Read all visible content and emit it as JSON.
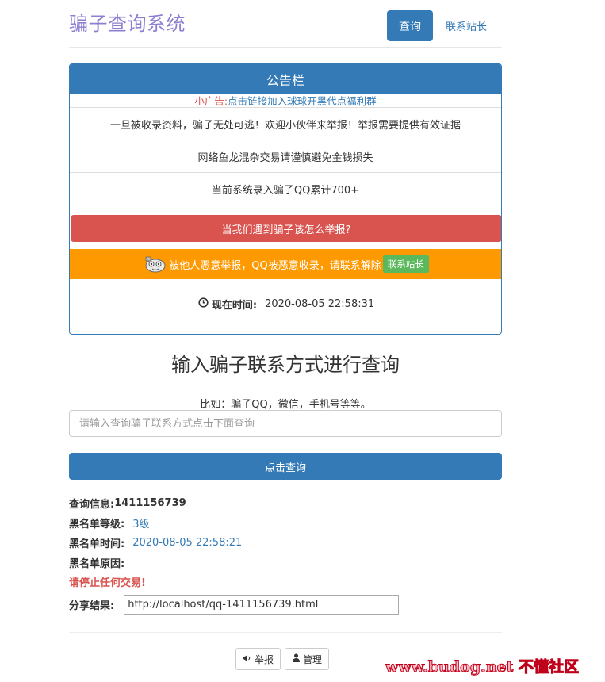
{
  "header": {
    "brand": "骗子查询系统",
    "nav_query": "查询",
    "nav_contact": "联系站长"
  },
  "panel": {
    "title": "公告栏",
    "ad_prefix": "小广告:",
    "ad_link": "点击链接加入球球开黑代点福利群",
    "notices": [
      "一旦被收录资料，骗子无处可逃！欢迎小伙伴来举报！举报需要提供有效证据",
      "网络鱼龙混杂交易请谨慎避免金钱损失",
      "当前系统录入骗子QQ累计700+"
    ],
    "report_button": "当我们遇到骗子该怎么举报?",
    "complaint_text": "被他人恶意举报，QQ被恶意收录，请联系解除",
    "contact_badge": "联系站长",
    "time_label": "现在时间:",
    "time_value": "2020-08-05 22:58:31"
  },
  "search": {
    "title": "输入骗子联系方式进行查询",
    "hint": "比如：骗子QQ，微信，手机号等等。",
    "placeholder": "请输入查询骗子联系方式点击下面查询",
    "submit": "点击查询"
  },
  "result": {
    "query_label": "查询信息:",
    "query_value": "1411156739",
    "level_label": "黑名单等级:",
    "level_value": "3级",
    "time_label": "黑名单时间:",
    "time_value": "2020-08-05 22:58:21",
    "reason_label": "黑名单原因:",
    "warning": "请停止任何交易!",
    "share_label": "分享结果:",
    "share_value": "http://localhost/qq-1411156739.html"
  },
  "footer": {
    "report": "举报",
    "admin": "管理"
  },
  "watermark": "www.budog.net 不懂社区",
  "colors": {
    "primary": "#337ab7",
    "danger": "#d9534f",
    "warning": "#ff9900",
    "success": "#5cb85c",
    "brand": "#8c7fd0"
  }
}
